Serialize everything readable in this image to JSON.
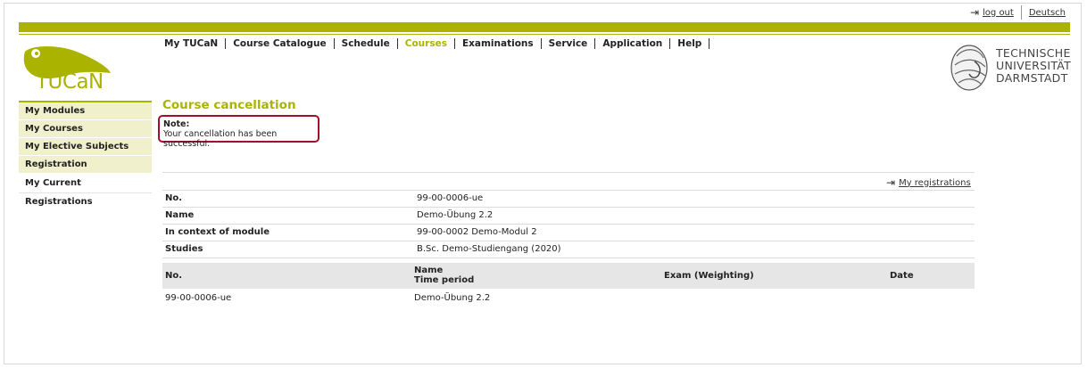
{
  "header": {
    "logout_label": "log out",
    "language_label": "Deutsch"
  },
  "logo": {
    "text": "TUCaN"
  },
  "university": {
    "line1": "TECHNISCHE",
    "line2": "UNIVERSITÄT",
    "line3": "DARMSTADT"
  },
  "nav": {
    "items": [
      {
        "label": "My TUCaN"
      },
      {
        "label": "Course Catalogue"
      },
      {
        "label": "Schedule"
      },
      {
        "label": "Courses"
      },
      {
        "label": "Examinations"
      },
      {
        "label": "Service"
      },
      {
        "label": "Application"
      },
      {
        "label": "Help"
      }
    ],
    "active_index": 3
  },
  "sidebar": {
    "items": [
      {
        "label": "My Modules"
      },
      {
        "label": "My Courses"
      },
      {
        "label": "My Elective Subjects"
      },
      {
        "label": "Registration"
      },
      {
        "label": "My Current Registrations"
      }
    ]
  },
  "main": {
    "title": "Course cancellation",
    "note_label": "Note:",
    "note_text": "Your cancellation has been successful.",
    "my_registrations_link": "My registrations",
    "info": [
      {
        "key": "No.",
        "value": "99-00-0006-ue"
      },
      {
        "key": "Name",
        "value": "Demo-Übung 2.2"
      },
      {
        "key": "In context of module",
        "value": "99-00-0002 Demo-Modul 2"
      },
      {
        "key": "Studies",
        "value": "B.Sc. Demo-Studiengang (2020)"
      }
    ],
    "table": {
      "headers": {
        "no": "No.",
        "name": "Name",
        "time_period": "Time period",
        "exam": "Exam  (Weighting)",
        "date": "Date"
      },
      "rows": [
        {
          "no": "99-00-0006-ue",
          "name": "Demo-Übung 2.2"
        }
      ]
    }
  },
  "colors": {
    "accent": "#aab400",
    "note_border": "#a0102a",
    "sidebar_bg": "#f0f0cc"
  }
}
